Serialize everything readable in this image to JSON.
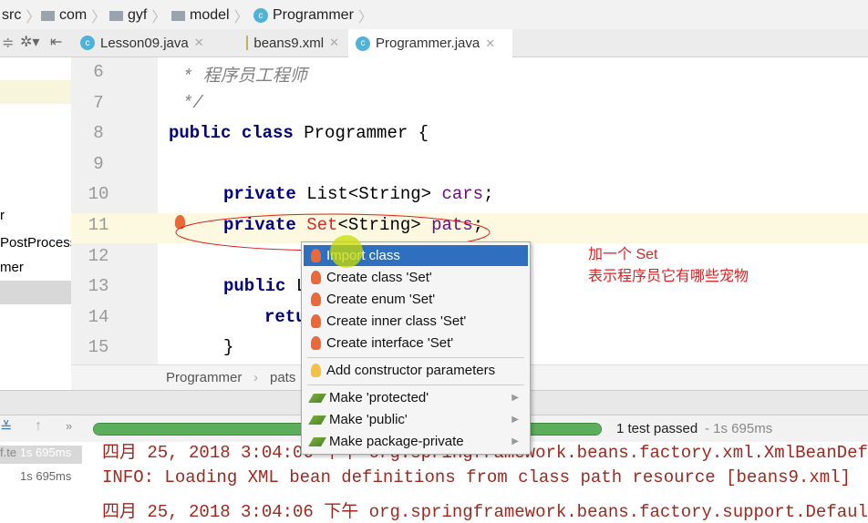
{
  "breadcrumb": [
    "src",
    "com",
    "gyf",
    "model",
    "Programmer"
  ],
  "tabs": [
    {
      "label": "Lesson09.java"
    },
    {
      "label": "beans9.xml"
    },
    {
      "label": "Programmer.java",
      "active": true
    }
  ],
  "sidebar": [
    "r",
    "PostProcess",
    "mer"
  ],
  "code": {
    "lines": [
      {
        "n": "6",
        "text": "* 程序员工程师"
      },
      {
        "n": "7",
        "text": "*/"
      },
      {
        "n": "8",
        "text": "public class Programmer {"
      },
      {
        "n": "9",
        "text": ""
      },
      {
        "n": "10",
        "text": "private List<String> cars;"
      },
      {
        "n": "11",
        "text": "private Set<String> pats;"
      },
      {
        "n": "12",
        "text": ""
      },
      {
        "n": "13",
        "text": "public Li"
      },
      {
        "n": "14",
        "text": "retur"
      },
      {
        "n": "15",
        "text": "}"
      }
    ]
  },
  "code_breadcrumb": {
    "class": "Programmer",
    "field": "pats"
  },
  "popup": {
    "items": [
      "Import class",
      "Create class 'Set'",
      "Create enum 'Set'",
      "Create inner class 'Set'",
      "Create interface 'Set'",
      "Add constructor parameters",
      "Make 'protected'",
      "Make 'public'",
      "Make package-private"
    ]
  },
  "annotation": {
    "line1": "加一个 Set",
    "line2": "表示程序员它有哪些宠物"
  },
  "run": {
    "status": "1 test passed",
    "time": " - 1s 695ms",
    "progress": 1.0,
    "tree": [
      {
        "label": "f.te",
        "time": "1s 695ms"
      },
      {
        "label": "",
        "time": "1s 695ms"
      }
    ]
  },
  "console": [
    "四月 25, 2018 3:04:06 下午 org.springframework.beans.factory.xml.XmlBeanDef",
    "INFO: Loading XML bean definitions from class path resource [beans9.xml]",
    "四月 25, 2018 3:04:06 下午 org.springframework.beans.factory.support.Defaul"
  ],
  "colors": {
    "accent": "#2f6fc0",
    "error": "#d62a2a",
    "annotation": "#e02020",
    "progress": "#5cae5c"
  }
}
